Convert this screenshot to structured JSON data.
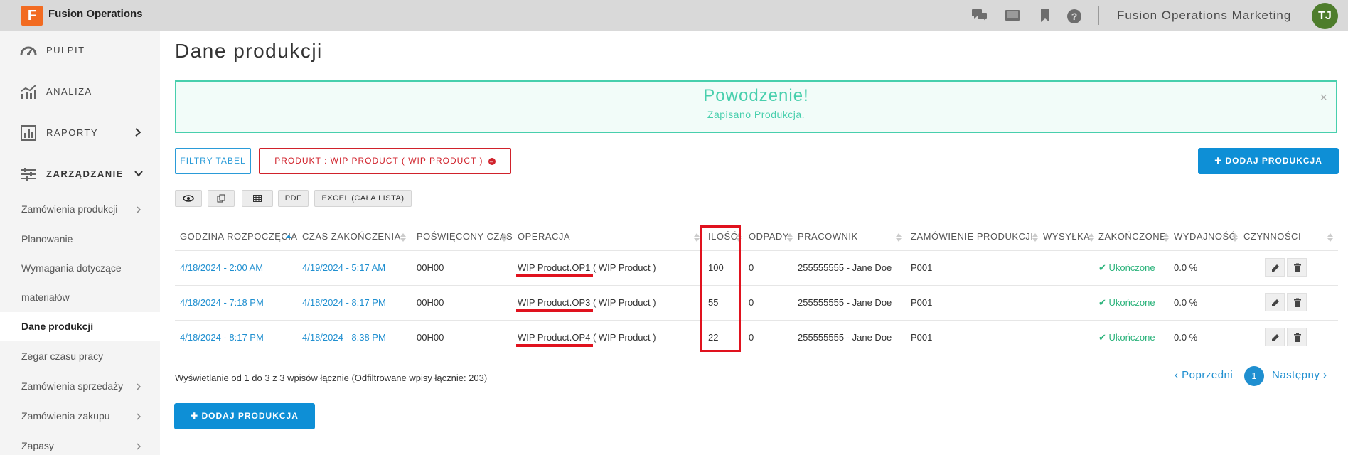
{
  "app": {
    "logo_letter": "F",
    "title": "Fusion Operations",
    "account": "Fusion Operations Marketing",
    "avatar": "TJ"
  },
  "topbar_icons": [
    "chat-icon",
    "screen-icon",
    "bookmark-icon",
    "help-icon"
  ],
  "sidebar": {
    "main": [
      {
        "label": "PULPIT",
        "icon": "dashboard-icon"
      },
      {
        "label": "ANALIZA",
        "icon": "analytics-icon"
      },
      {
        "label": "RAPORTY",
        "icon": "reports-icon"
      },
      {
        "label": "ZARZĄDZANIE",
        "icon": "sliders-icon"
      }
    ],
    "sub": [
      {
        "label": "Zamówienia produkcji"
      },
      {
        "label": "Planowanie"
      },
      {
        "label": "Wymagania dotyczące"
      },
      {
        "label": "materiałów"
      },
      {
        "label": "Dane produkcji"
      },
      {
        "label": "Zegar czasu pracy"
      },
      {
        "label": "Zamówienia sprzedaży"
      },
      {
        "label": "Zamówienia zakupu"
      },
      {
        "label": "Zapasy"
      }
    ]
  },
  "page": {
    "title": "Dane produkcji"
  },
  "alert": {
    "title": "Powodzenie!",
    "message": "Zapisano Produkcja.",
    "close": "×"
  },
  "toolbar": {
    "filter_label": "FILTRY TABEL",
    "chip_label": "PRODUKT : WIP PRODUCT ( WIP PRODUCT )",
    "chip_x": "–",
    "add_label": "✚ DODAJ PRODUKCJA",
    "pdf_label": "PDF",
    "excel_label": "EXCEL (CAŁA LISTA)"
  },
  "table": {
    "headers": [
      "GODZINA ROZPOCZĘCIA",
      "CZAS ZAKOŃCZENIA",
      "POŚWIĘCONY CZAS",
      "OPERACJA",
      "ILOŚĆ",
      "ODPADY",
      "PRACOWNIK",
      "ZAMÓWIENIE PRODUKCJI",
      "WYSYŁKA",
      "ZAKOŃCZONE",
      "WYDAJNOŚĆ",
      "CZYNNOŚCI"
    ],
    "rows": [
      {
        "start": "4/18/2024 - 2:00 AM",
        "end": "4/19/2024 - 5:17 AM",
        "spent": "00H00",
        "operation": "WIP Product.OP1",
        "operation_suffix": " ( WIP Product )",
        "qty": "100",
        "scrap": "0",
        "worker": "255555555 - Jane Doe",
        "order": "P001",
        "shipping": "",
        "completed": "✔ Ukończone",
        "efficiency": "0.0 %"
      },
      {
        "start": "4/18/2024 - 7:18 PM",
        "end": "4/18/2024 - 8:17 PM",
        "spent": "00H00",
        "operation": "WIP Product.OP3",
        "operation_suffix": " ( WIP Product  )",
        "qty": "55",
        "scrap": "0",
        "worker": "255555555 - Jane Doe",
        "order": "P001",
        "shipping": "",
        "completed": "✔ Ukończone",
        "efficiency": "0.0 %"
      },
      {
        "start": "4/18/2024 - 8:17 PM",
        "end": "4/18/2024 - 8:38 PM",
        "spent": "00H00",
        "operation": "WIP Product.OP4",
        "operation_suffix": " ( WIP Product  )",
        "qty": "22",
        "scrap": "0",
        "worker": "255555555 - Jane Doe",
        "order": "P001",
        "shipping": "",
        "completed": "✔ Ukończone",
        "efficiency": "0.0 %"
      }
    ]
  },
  "footer": {
    "info": "Wyświetlanie od 1 do 3 z 3 wpisów łącznie (Odfiltrowane wpisy łącznie: 203)",
    "prev": "‹ Poprzedni",
    "page": "1",
    "next": "Następny ›",
    "add_label": "✚ DODAJ PRODUKCJA"
  },
  "colors": {
    "accent": "#0e8fd6",
    "link": "#1f8fd0",
    "success": "#48cfad",
    "danger": "#d0222b",
    "highlight": "#e0121e"
  }
}
